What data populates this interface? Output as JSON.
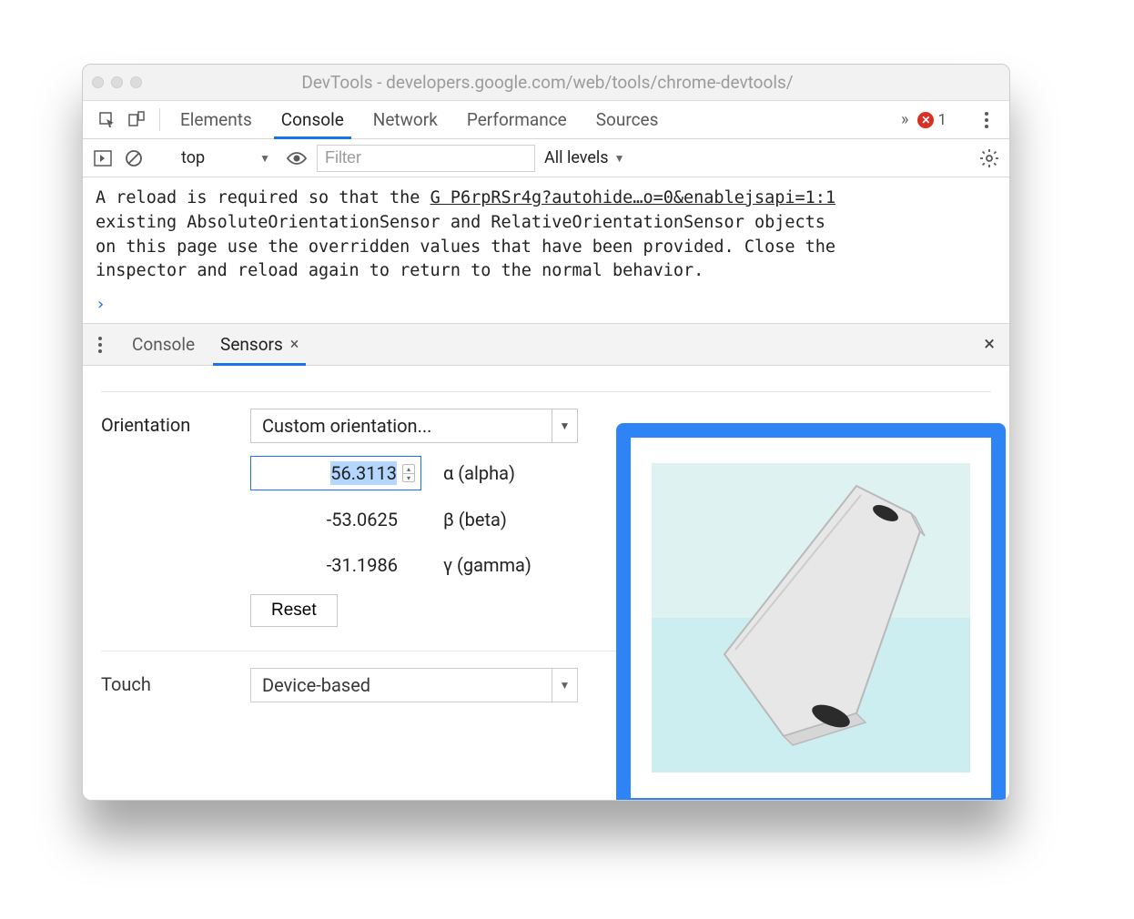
{
  "window": {
    "title": "DevTools - developers.google.com/web/tools/chrome-devtools/"
  },
  "main_tabs": {
    "items": [
      "Elements",
      "Console",
      "Network",
      "Performance",
      "Sources"
    ],
    "active": "Console",
    "more_glyph": "»",
    "error_count": "1"
  },
  "console_bar": {
    "context": "top",
    "filter_placeholder": "Filter",
    "levels": "All levels"
  },
  "console_message": {
    "line1_a": "A reload is required so that the ",
    "line1_link": "G P6rpRSr4g?autohide…o=0&enablejsapi=1:1",
    "line2": "existing AbsoluteOrientationSensor and RelativeOrientationSensor objects",
    "line3": "on this page use the overridden values that have been provided. Close the",
    "line4": "inspector and reload again to return to the normal behavior."
  },
  "prompt_glyph": "›",
  "drawer": {
    "tabs": [
      "Console",
      "Sensors"
    ],
    "active": "Sensors",
    "close_glyph": "×"
  },
  "orientation": {
    "label": "Orientation",
    "preset": "Custom orientation...",
    "alpha_value": "56.3113",
    "alpha_label": "α (alpha)",
    "beta_value": "-53.0625",
    "beta_label": "β (beta)",
    "gamma_value": "-31.1986",
    "gamma_label": "γ (gamma)",
    "reset": "Reset"
  },
  "touch": {
    "label": "Touch",
    "preset": "Device-based"
  }
}
